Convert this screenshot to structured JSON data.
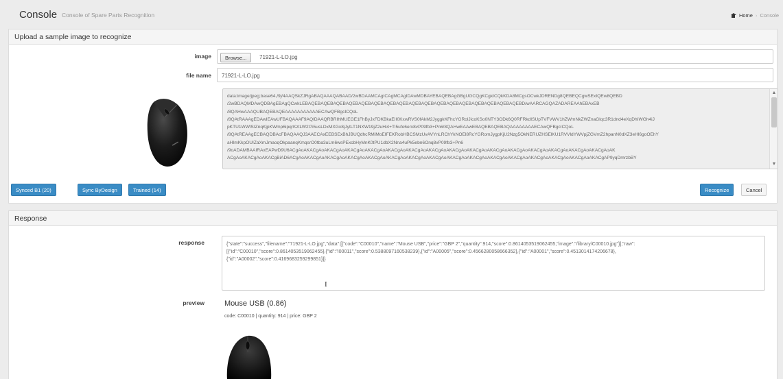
{
  "header": {
    "title": "Console",
    "subtitle": "Console of Spare Parts Recognition",
    "breadcrumb": {
      "home": "Home",
      "current": "Console"
    }
  },
  "upload": {
    "heading": "Upload a sample image to recognize",
    "image_label": "image",
    "browse_label": "Browse...",
    "selected_file": "71921-L-LO.jpg",
    "file_name_label": "file name",
    "file_name_value": "71921-L-LO.jpg",
    "base64_lines": [
      "data:image/jpeg;base64,/9j/4AAQSkZJRgABAQAAAQABAAD/2wBDAAMCAgICAgMCAgIDAwMDBAYEBAQEBAgGBgUGCQgKCgkICQkKDA8MCgsOCwkJDRENDg8QEBEQCgwSExIQEw8QEBD",
      "/2wBDAQMDAwQDBAgEBAgQCwkLEBAQEBAQEBAQEBAQEBAQEBAQEBAQEBAQEBAQEBAQEBAQEBAQEBAQEBAQEBAQEBAQEBAQEBD/wAARCAGQAZADAREAAhEBAxEB",
      "/8QAHwAAAQUBAQEBAQEAAAAAAAAAAAECAwQFBgcICQoL",
      "/8QAtRAAAgEDAwIEAwUFBAQAAAF9AQIDAAQRBRIhMUEGE1FhByJxFDKBkaEII0KxwRVS0fAkM2JyggkKFhcYGRolJicoKSo0NTY3ODk6Q0RFRkdISUpTVFVWV1hZWmNkZWZnaGlqc3R1dnd4eXqDhIWGh4iJ",
      "pKTU1WWlSIZnqKjpKWmp6ipqrKztLW2t7i5usLDxMXGx8jJytLT1NXW19jZ2uHi4+Tl5ufo6erx8vP09fb3+Pn6/8QAHwEAAwEBAQEBAQEBAQAAAAAAAAECAwQFBgcICQoL",
      "/8QAtREAAgECBAQDBAcFBAQAAQJ3AAECAxEEBSExBhJBUQdhcRMiMoEIFEKRobHBCSMzUvAVYnLRChYkNOEl8RcYGRomJygpKjU2Nzg5OkNERUZHSElKU1RVVldYWVpjZGVmZ2hpanN0dXZ3eHl6goOEhY",
      "aHImKkpOUIZaXmJmaoqOkpaanqKmqsrO0tba3uLm6wsPExcbHyMnK0tPU1dbX2Nna4uPk5ebn6Onq8vP09fb3+Pn6",
      "/9oADAMBAAIRAxEAPwD9U6ACgAoAKACgAoAKACgAoAKACgAoAKACgAoAKACgAoAKACgAoAKACgAoAKACgAoAKACgAoAKACgAoAKACgAoAKACgAoAKACgAoAKACgAoAKACgAoAK",
      "ACgAoAKACgAoAKACgBiAD6ACgAoAKACgAoAKACgAoAKACgAoAKACgAoAKACgAoAKACgAoAKACgAoAKACgAoAKACgAoAKACgAoAKACgAoAKACgAoAKACgAoAKACgAoAKACgAP9yqDmrzbBY"
    ],
    "buttons": {
      "synced": "Synced B1 (20)",
      "sync_bydesign": "Sync ByDesign",
      "trained": "Trained (14)",
      "recognize": "Recognize",
      "cancel": "Cancel"
    }
  },
  "response": {
    "heading": "Response",
    "response_label": "response",
    "response_lines": [
      "{\"state\":\"success\",\"filename\":\"71921-L-LO.jpg\",\"data\":[{\"code\":\"C00010\",\"name\":\"Mouse USB\",\"price\":\"GBP 2\",\"quantity\":914,\"score\":0.8614053519062455,\"image\":\"/library/C00010.jpg\"}],\"raw\":",
      "[{\"id\":\"C00010\",\"score\":0.8614053519062455},{\"id\":\"I00011\",\"score\":0.5388097160538239},{\"id\":\"A00005\",\"score\":0.4566280058666352},{\"id\":\"A00001\",\"score\":0.4513014174206678},",
      "{\"id\":\"A00002\",\"score\":0.4169683259299851}]}"
    ],
    "preview_label": "preview",
    "preview_title": "Mouse USB (0.86)",
    "preview_meta": "code: C00010 | quantity: 914 | price: GBP 2"
  },
  "icons": {
    "home": "home-icon",
    "mouse_thumbnail": "mouse-image",
    "mouse_preview": "mouse-preview-image",
    "text_cursor": "text-cursor-icon"
  },
  "colors": {
    "primary": "#3a8cc5",
    "background": "#ececec"
  }
}
